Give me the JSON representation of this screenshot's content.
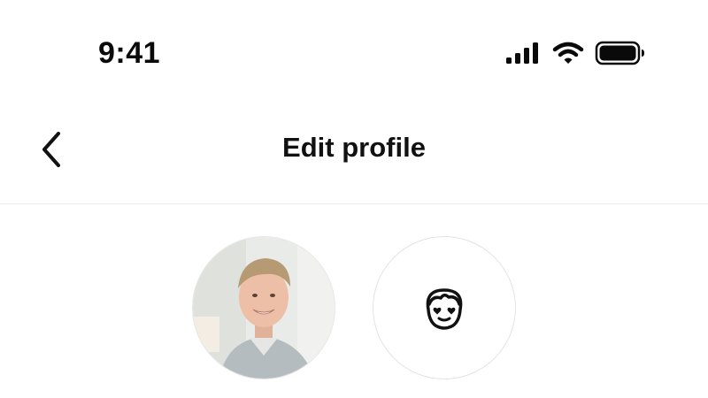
{
  "status_bar": {
    "time": "9:41",
    "icons": [
      "cellular-signal-icon",
      "wifi-icon",
      "battery-icon"
    ]
  },
  "header": {
    "title": "Edit profile",
    "back_icon": "chevron-left-icon"
  },
  "avatars": {
    "items": [
      {
        "type": "photo",
        "name": "profile-photo"
      },
      {
        "type": "avatar",
        "icon": "avatar-character-icon"
      }
    ]
  },
  "colors": {
    "background": "#ffffff",
    "text": "#111111",
    "divider": "#ececec",
    "avatar_border": "#e3e3e3"
  }
}
